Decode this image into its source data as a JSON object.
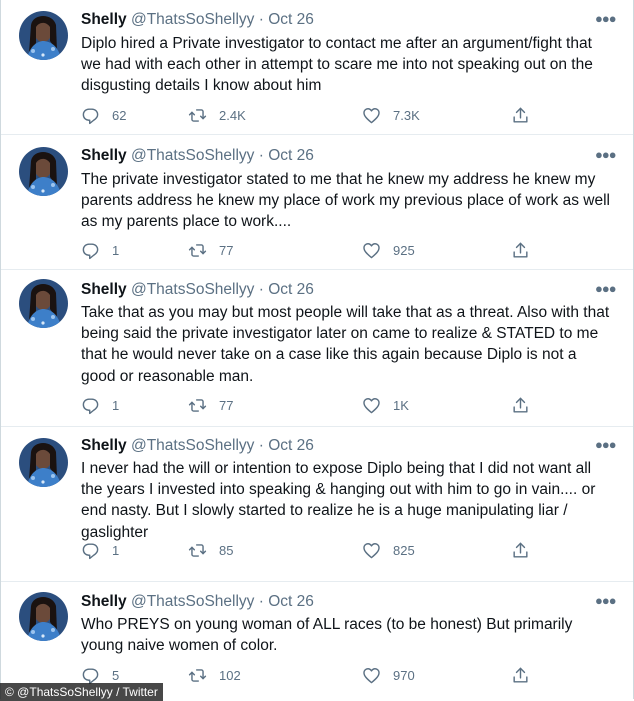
{
  "tweets": [
    {
      "name": "Shelly",
      "handle": "@ThatsSoShellyy",
      "separator": "·",
      "date": "Oct 26",
      "text": "Diplo hired a Private investigator to contact me after an argument/fight that we had with each other in attempt to scare me into not speaking out on the disgusting details I know about him",
      "replies": "62",
      "retweets": "2.4K",
      "likes": "7.3K"
    },
    {
      "name": "Shelly",
      "handle": "@ThatsSoShellyy",
      "separator": "·",
      "date": "Oct 26",
      "text": "The private investigator stated to me that he knew my address he knew my parents address he knew my place of work my previous place of work as well as my parents place to work....",
      "replies": "1",
      "retweets": "77",
      "likes": "925"
    },
    {
      "name": "Shelly",
      "handle": "@ThatsSoShellyy",
      "separator": "·",
      "date": "Oct 26",
      "text": "Take that as you may but most people will take that as a threat. Also with that being said the private investigator later on came to realize & STATED to me that he would never take on a case like this again because Diplo is not a good or reasonable man.",
      "replies": "1",
      "retweets": "77",
      "likes": "1K"
    },
    {
      "name": "Shelly",
      "handle": "@ThatsSoShellyy",
      "separator": "·",
      "date": "Oct 26",
      "text": "I never had the will or intention to expose Diplo being that I did not want all the years I invested into speaking & hanging out with him to go in vain.... or end nasty. But I slowly started to realize he is a huge manipulating liar / gaslighter",
      "replies": "1",
      "retweets": "85",
      "likes": "825"
    },
    {
      "name": "Shelly",
      "handle": "@ThatsSoShellyy",
      "separator": "·",
      "date": "Oct 26",
      "text": "Who PREYS on young woman of ALL races (to be honest) But primarily young  naive women of color.",
      "replies": "5",
      "retweets": "102",
      "likes": "970"
    }
  ],
  "credit": "© @ThatsSoShellyy / Twitter",
  "icons": {
    "avatar": "avatar-image",
    "more": "more-options-icon",
    "reply": "reply-icon",
    "retweet": "retweet-icon",
    "like": "heart-icon",
    "share": "share-icon"
  },
  "colors": {
    "text": "#0f1419",
    "secondary": "#5b7083",
    "divider": "#e6ecf0"
  }
}
